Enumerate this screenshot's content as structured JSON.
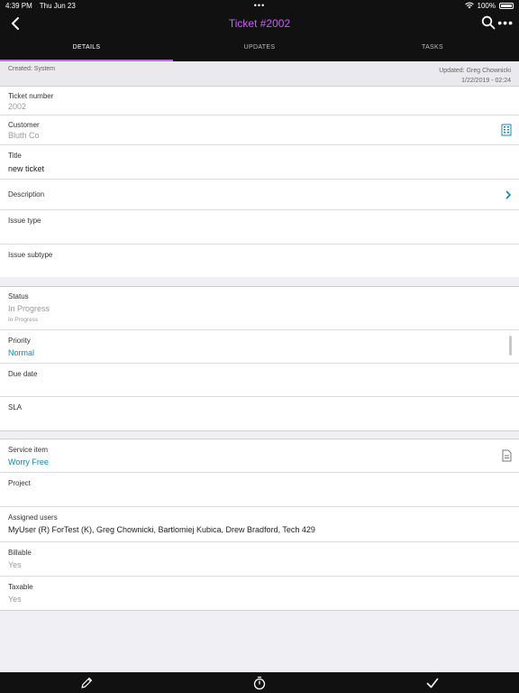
{
  "status_bar": {
    "time": "4:39 PM",
    "date": "Thu Jun 23",
    "dots": "•••",
    "battery": "100%"
  },
  "header": {
    "title": "Ticket #2002"
  },
  "tabs": [
    {
      "label": "DETAILS"
    },
    {
      "label": "UPDATES"
    },
    {
      "label": "TASKS"
    }
  ],
  "meta": {
    "created": "Created: System",
    "updated_by": "Updated: Greg Chownicki",
    "updated_at": "1/22/2019 - 02:24"
  },
  "section1": {
    "ticket_number": {
      "label": "Ticket number",
      "value": "2002"
    },
    "customer": {
      "label": "Customer",
      "value": "Bluth Co"
    },
    "title": {
      "label": "Title",
      "value": "new ticket"
    },
    "description": {
      "label": "Description"
    },
    "issue_type": {
      "label": "Issue type"
    },
    "issue_subtype": {
      "label": "Issue subtype"
    }
  },
  "section2": {
    "status": {
      "label": "Status",
      "value": "In Progress",
      "sub": "In Progress"
    },
    "priority": {
      "label": "Priority",
      "value": "Normal"
    },
    "due_date": {
      "label": "Due date"
    },
    "sla": {
      "label": "SLA"
    }
  },
  "section3": {
    "service_item": {
      "label": "Service item",
      "value": "Worry Free"
    },
    "project": {
      "label": "Project"
    },
    "assigned_users": {
      "label": "Assigned users",
      "value": "MyUser (R) ForTest (K), Greg Chownicki, Bartlomiej Kubica, Drew Bradford, Tech 429"
    },
    "billable": {
      "label": "Billable",
      "value": "Yes"
    },
    "taxable": {
      "label": "Taxable",
      "value": "Yes"
    }
  },
  "colors": {
    "accent": "#c85ff0",
    "link": "#1b86b3",
    "bar": "#111111"
  },
  "icons": [
    "chevron-left-icon",
    "search-icon",
    "more-icon",
    "building-icon",
    "chevron-right-icon",
    "document-icon",
    "pencil-icon",
    "timer-icon",
    "check-icon"
  ]
}
